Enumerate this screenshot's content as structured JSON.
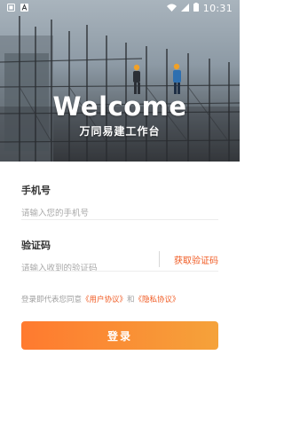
{
  "status_bar": {
    "time": "10:31",
    "icons": [
      "notification-box-icon",
      "app-a-icon",
      "wifi-icon",
      "signal-icon",
      "battery-icon"
    ]
  },
  "hero": {
    "title": "Welcome",
    "subtitle": "万同易建工作台"
  },
  "form": {
    "phone": {
      "label": "手机号",
      "placeholder": "请输入您的手机号",
      "value": ""
    },
    "code": {
      "label": "验证码",
      "placeholder": "请输入收到的验证码",
      "value": "",
      "get_code_label": "获取验证码"
    },
    "agreement": {
      "prefix": "登录即代表您同意",
      "user_agreement": "《用户协议》",
      "conjunction": "和",
      "privacy_agreement": "《隐私协议》"
    },
    "login_label": "登录"
  },
  "colors": {
    "accent": "#f05a22",
    "button_start": "#ff7a2f",
    "button_end": "#f5a23a",
    "placeholder": "#a8a8a8"
  }
}
